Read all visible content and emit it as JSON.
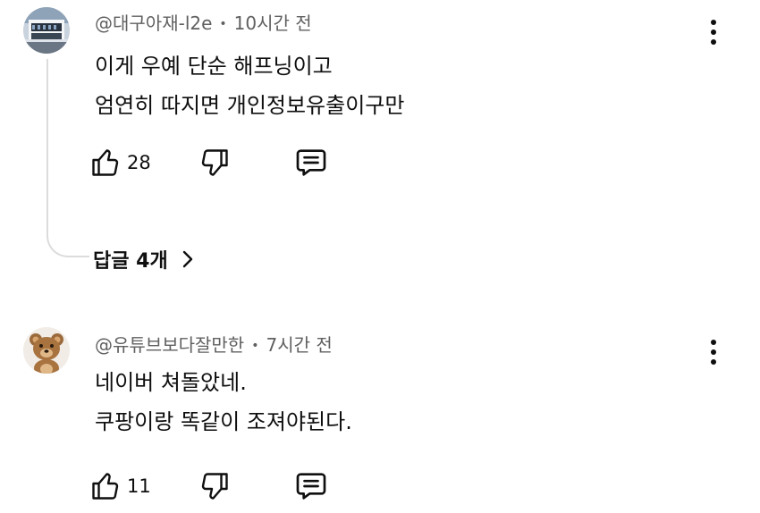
{
  "comments": [
    {
      "author": "@대구아재-l2e",
      "time": "10시간 전",
      "lines": [
        "이게 우예 단순 해프닝이고",
        "엄연히 따지면 개인정보유출이구만"
      ],
      "likes": "28",
      "replies_label": "답글 4개",
      "avatar_icon": "avatar-building-photo"
    },
    {
      "author": "@유튜브보다잘만한",
      "time": "7시간 전",
      "lines": [
        "네이버 쳐돌았네.",
        "쿠팡이랑 똑같이 조져야된다."
      ],
      "likes": "11",
      "avatar_icon": "avatar-teddy-bear"
    }
  ],
  "icons": {
    "like": "thumbs-up-icon",
    "dislike": "thumbs-down-icon",
    "reply": "reply-comment-icon",
    "more": "vertical-ellipsis-icon",
    "replies_chevron": "chevron-right-icon"
  },
  "colors": {
    "text": "#0f0f0f",
    "meta": "#606060",
    "thread_line": "#dcdcdc"
  }
}
